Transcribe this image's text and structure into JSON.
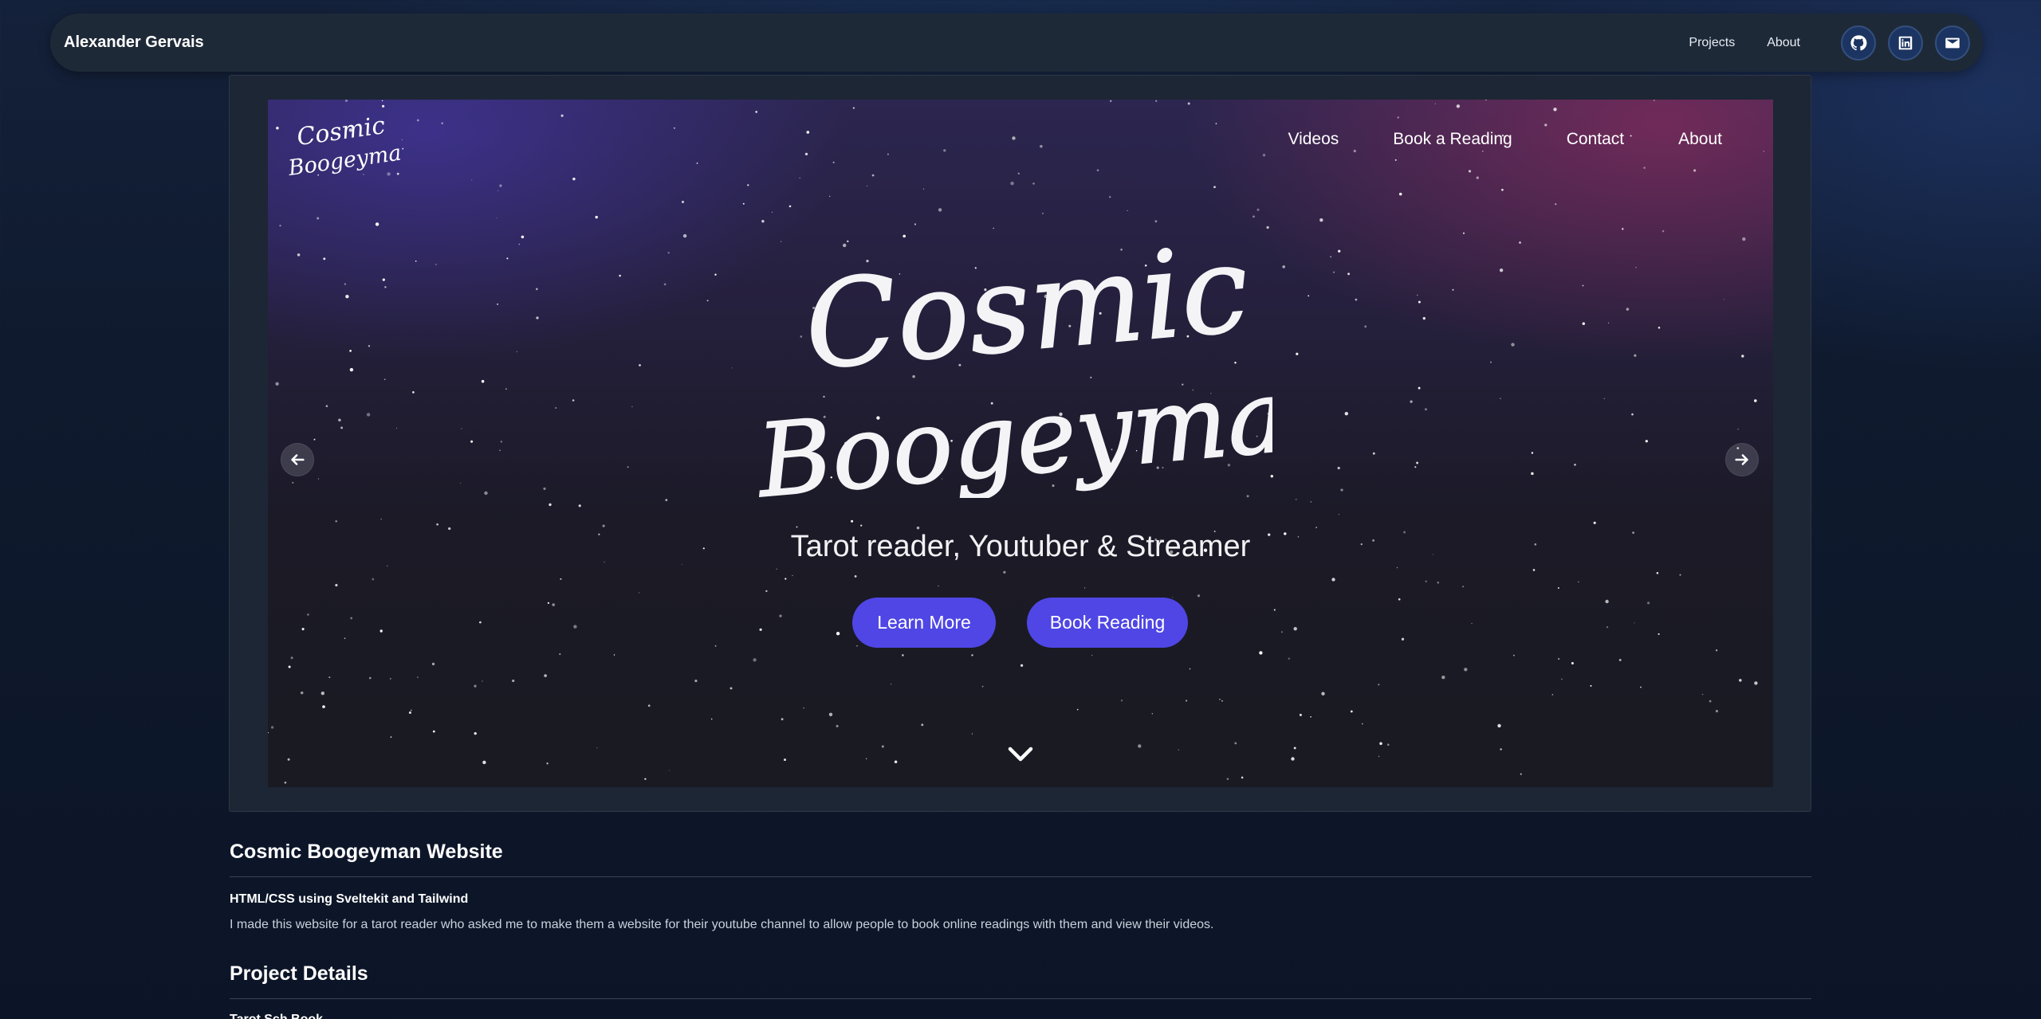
{
  "header": {
    "brand": "Alexander Gervais",
    "nav": [
      "Projects",
      "About"
    ],
    "icons": [
      "github-icon",
      "linkedin-icon",
      "mail-icon"
    ]
  },
  "hero": {
    "logo_text": "Cosmic Boogeyman",
    "nav": [
      "Videos",
      "Book a Reading",
      "Contact",
      "About"
    ],
    "title_line1": "Cosmic",
    "title_line2": "Boogeyman",
    "tagline": "Tarot reader, Youtuber & Streamer",
    "cta_primary": "Learn More",
    "cta_secondary": "Book Reading",
    "colors": {
      "button": "#4f46e5",
      "glow_left": "#463aa8",
      "glow_right": "#962d5f"
    }
  },
  "project": {
    "title": "Cosmic Boogeyman Website",
    "subtitle": "HTML/CSS using Sveltekit and Tailwind",
    "description": "I made this website for a tarot reader who asked me to make them a website for their youtube channel to allow people to book online readings with them and view their videos.",
    "details_heading": "Project Details",
    "details_first_item": "Tarot Sch Book"
  }
}
